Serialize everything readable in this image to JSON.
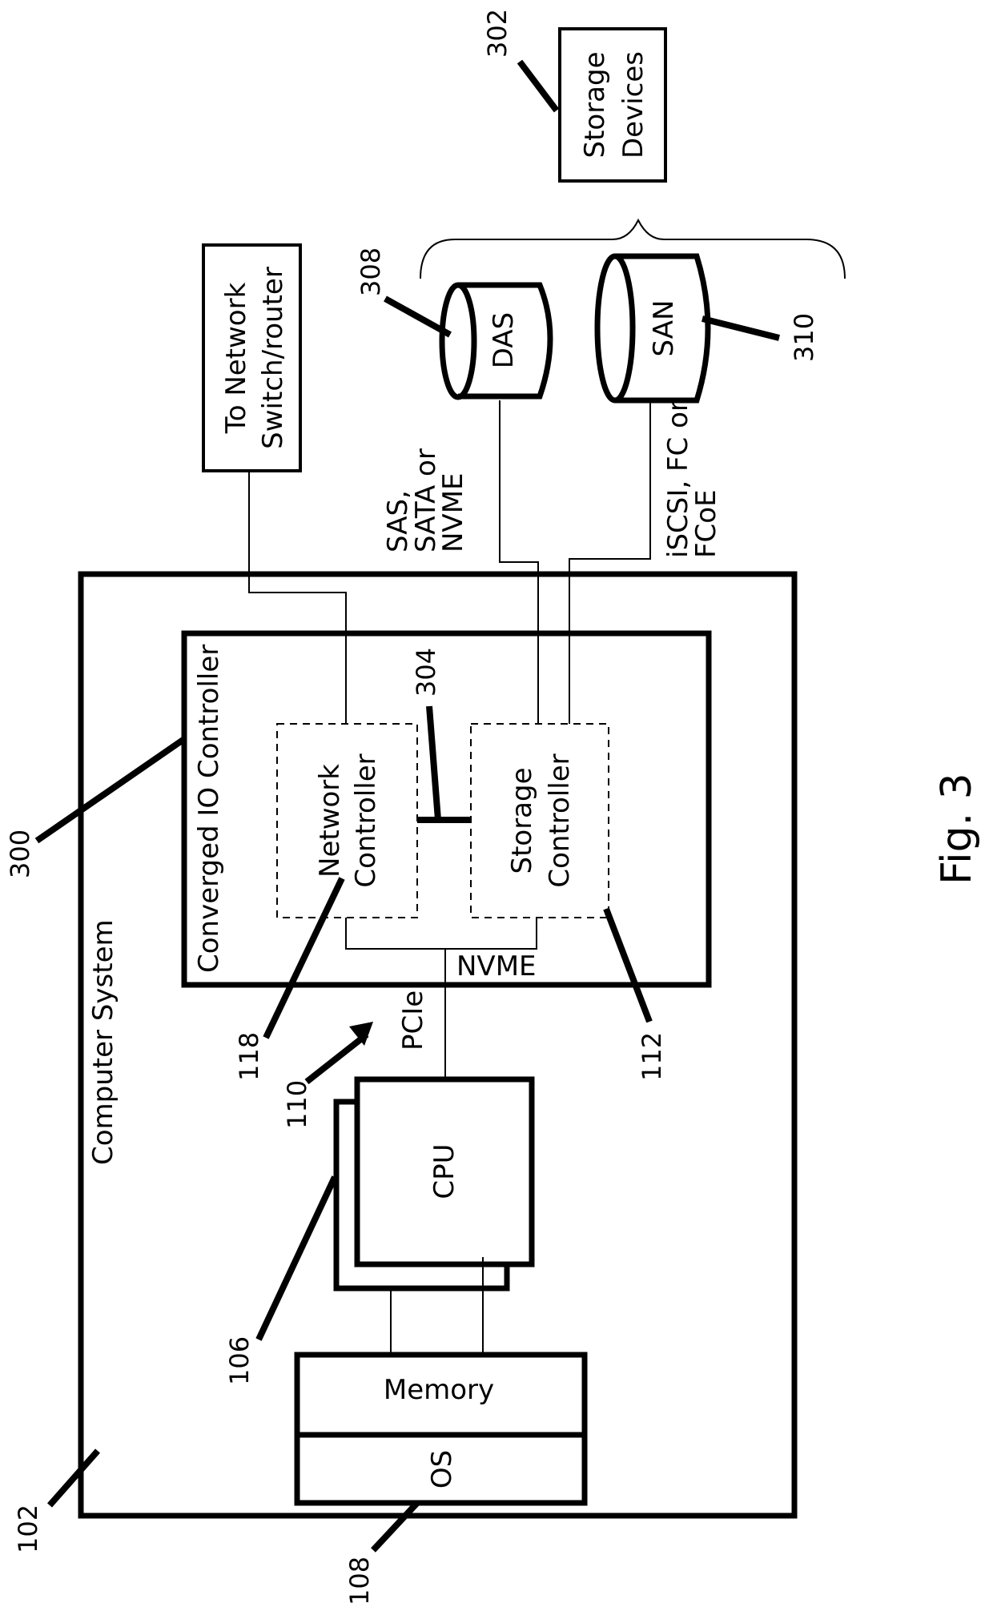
{
  "figure": {
    "caption": "Fig. 3",
    "orientation": "rotated 90 degrees counter-clockwise (landscape drawing on portrait page)"
  },
  "blocks": {
    "computer_system": {
      "label": "Computer System",
      "ref": "102"
    },
    "io_controller": {
      "label": "Converged  IO Controller",
      "ref": "300"
    },
    "network_controller": {
      "line1": "Network",
      "line2": "Controller",
      "ref": "118"
    },
    "storage_controller": {
      "line1": "Storage",
      "line2": "Controller",
      "ref": "112"
    },
    "controller_link": {
      "ref": "304"
    },
    "cpu": {
      "label": "CPU",
      "ref": "106"
    },
    "memory": {
      "label": "Memory"
    },
    "os": {
      "label": "OS",
      "ref": "108"
    },
    "network_switch": {
      "line1": "To Network",
      "line2": "Switch/router"
    },
    "storage_devices": {
      "line1": "Storage",
      "line2": "Devices",
      "ref": "302"
    },
    "das": {
      "label": "DAS",
      "ref": "308"
    },
    "san": {
      "label": "SAN",
      "ref": "310"
    }
  },
  "links": {
    "pcie": {
      "label": "PCIe",
      "ref": "110"
    },
    "nvme_internal": {
      "label": "NVME"
    },
    "das_protocols": {
      "line1": "SAS,",
      "line2": "SATA or",
      "line3": "NVME"
    },
    "san_protocols": {
      "line1": "iSCSI, FC or",
      "line2": "FCoE"
    }
  }
}
